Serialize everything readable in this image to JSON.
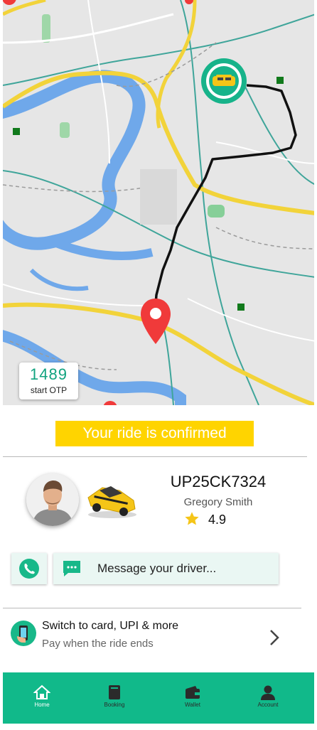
{
  "otp": {
    "code": "1489",
    "label": "start OTP"
  },
  "banner": {
    "text": "Your ride is confirmed"
  },
  "driver": {
    "plate": "UP25CK7324",
    "name": "Gregory Smith",
    "rating": "4.9"
  },
  "actions": {
    "message_placeholder": "Message your driver..."
  },
  "payment": {
    "title": "Switch to card, UPI & more",
    "subtitle": "Pay when the ride ends"
  },
  "nav": {
    "items": [
      {
        "label": "Home",
        "icon": "home-icon",
        "active": true
      },
      {
        "label": "Booking",
        "icon": "book-icon",
        "active": false
      },
      {
        "label": "Wallet",
        "icon": "wallet-icon",
        "active": false
      },
      {
        "label": "Account",
        "icon": "account-icon",
        "active": false
      }
    ]
  },
  "colors": {
    "accent": "#11b98a",
    "banner": "#ffd400",
    "pin": "#f03a3a",
    "route": "#111111",
    "otp_text": "#11a37f"
  }
}
